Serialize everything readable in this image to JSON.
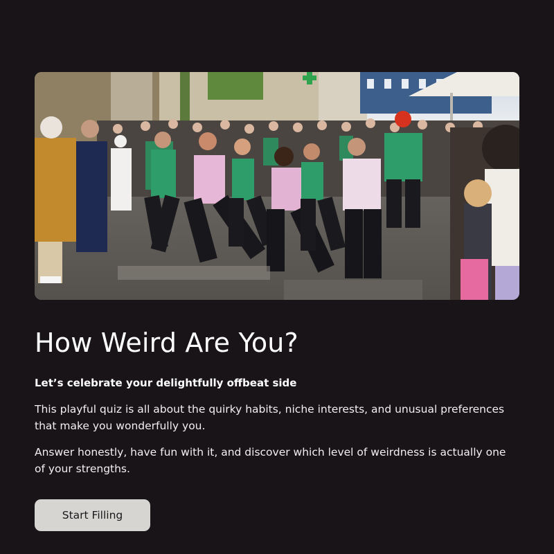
{
  "hero": {
    "image_description_icon": "festival-crowd-photo"
  },
  "content": {
    "title": "How Weird Are You?",
    "subtitle": "Let’s celebrate your delightfully offbeat side",
    "paragraphs": [
      "This playful quiz is all about the quirky habits, niche interests, and unusual preferences that make you wonderfully you.",
      "Answer honestly, have fun with it, and discover which level of weirdness is actually one of your strengths."
    ]
  },
  "actions": {
    "start_label": "Start Filling"
  },
  "colors": {
    "background": "#181418",
    "button_bg": "#d6d5d2",
    "button_text": "#1a171a",
    "text": "#ffffff"
  }
}
